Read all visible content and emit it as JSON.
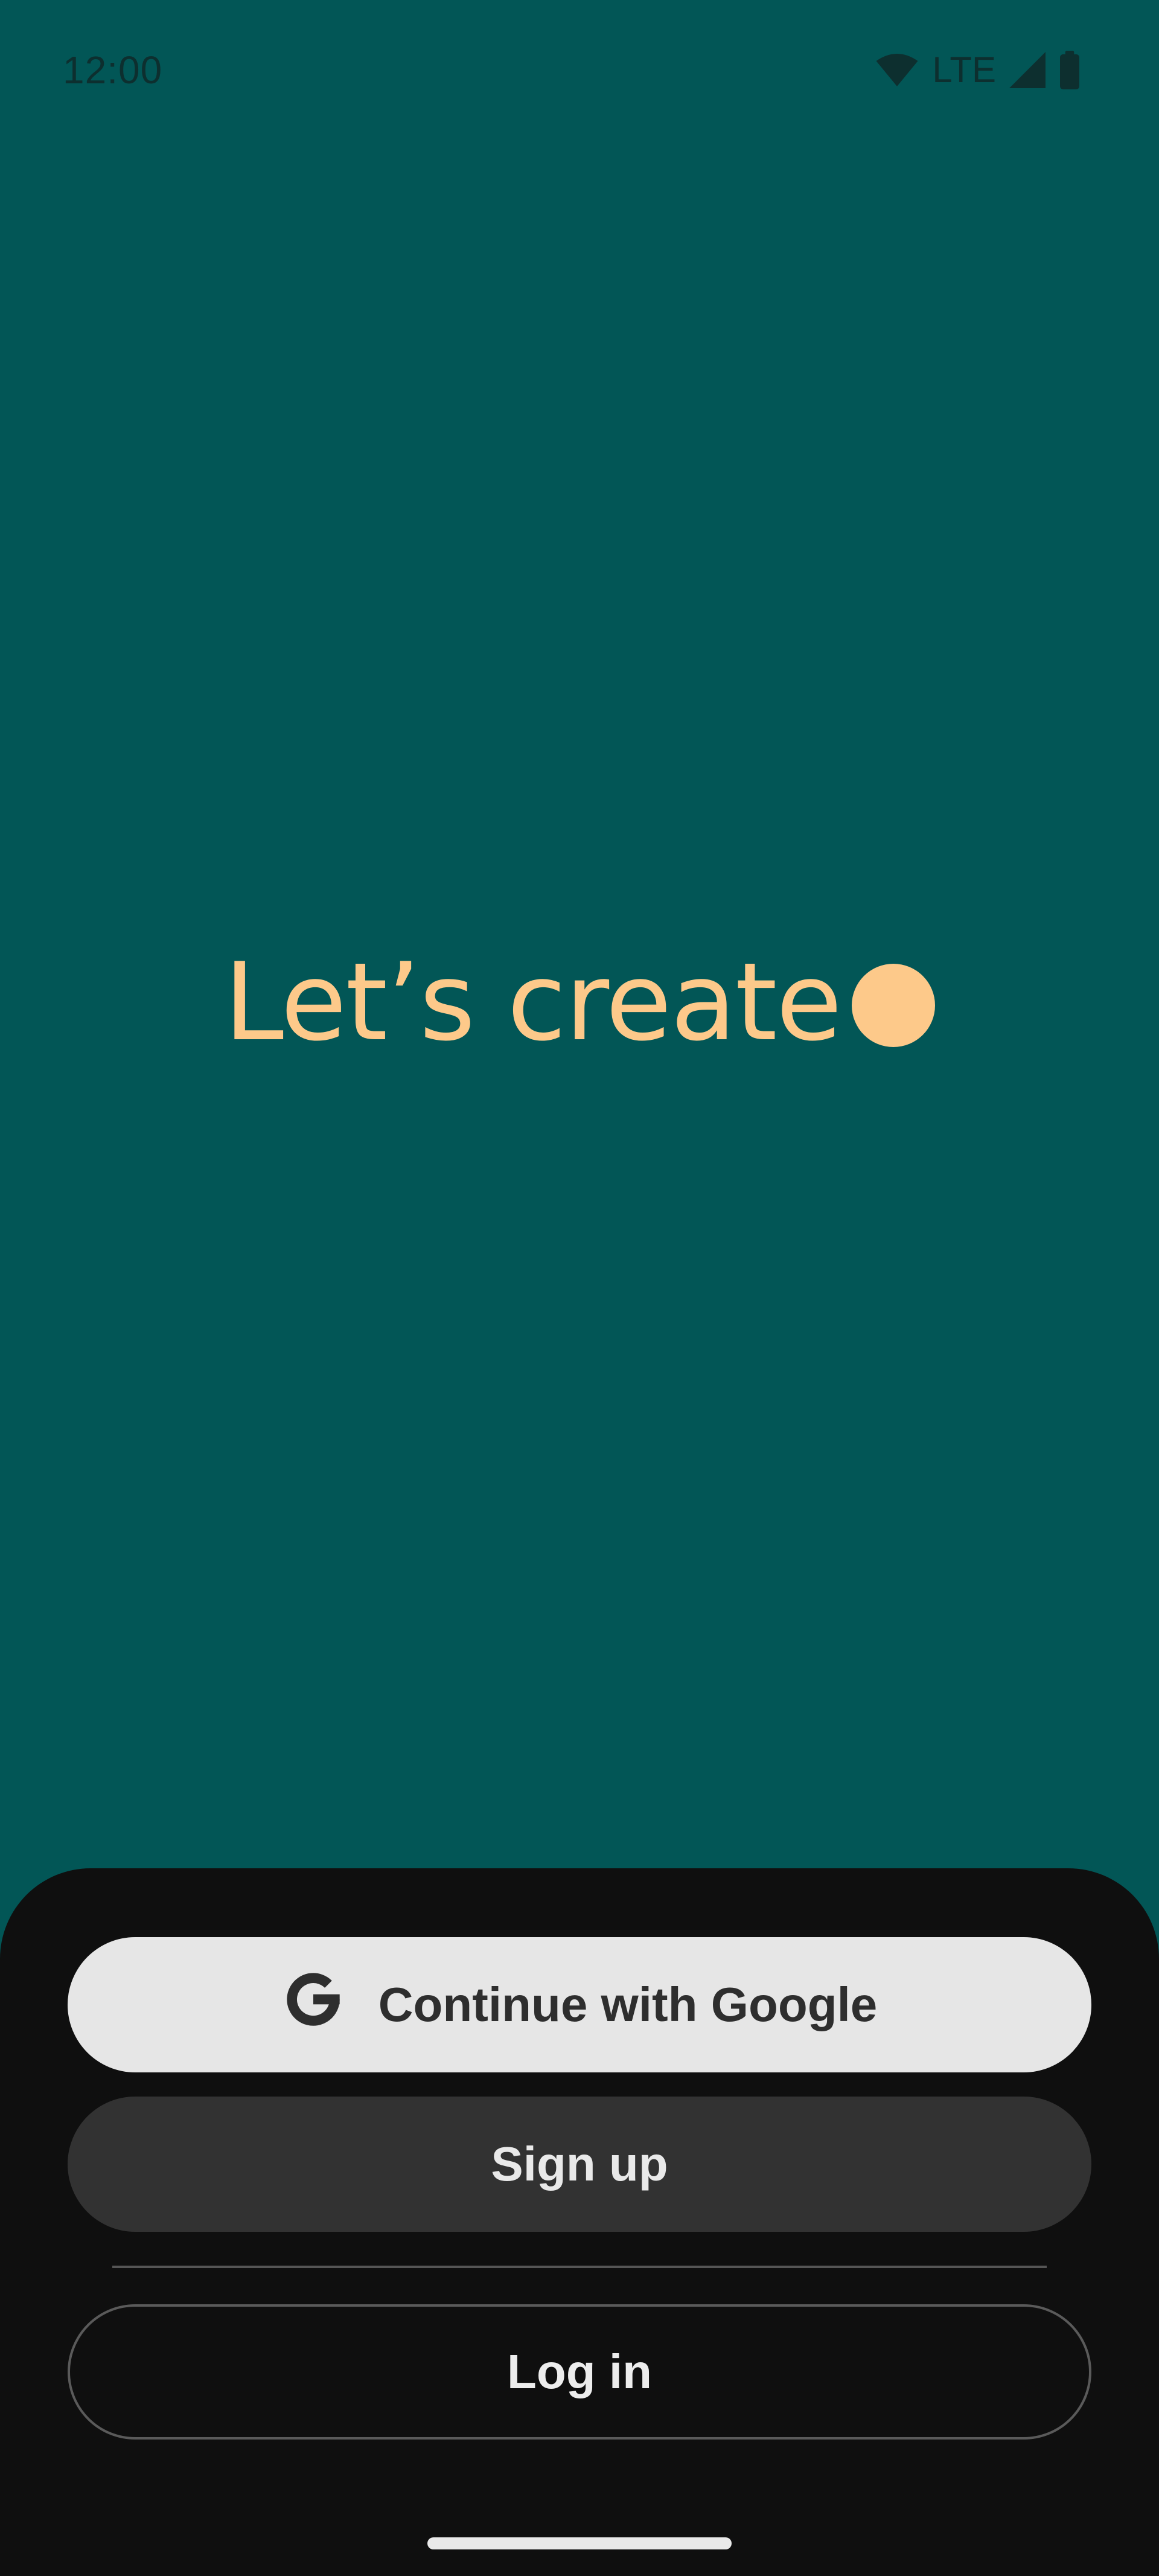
{
  "status_bar": {
    "time": "12:00",
    "network": "LTE",
    "icons": [
      "wifi-icon",
      "cellular-signal-icon",
      "battery-icon"
    ]
  },
  "hero": {
    "title": "Let’s create"
  },
  "actions": {
    "google_label": "Continue with Google",
    "signup_label": "Sign up",
    "login_label": "Log in"
  },
  "colors": {
    "background": "#025656",
    "accent": "#fdc98a",
    "sheet": "#0f0f0f",
    "google_button": "#e6e6e6",
    "signup_button": "#323232"
  }
}
